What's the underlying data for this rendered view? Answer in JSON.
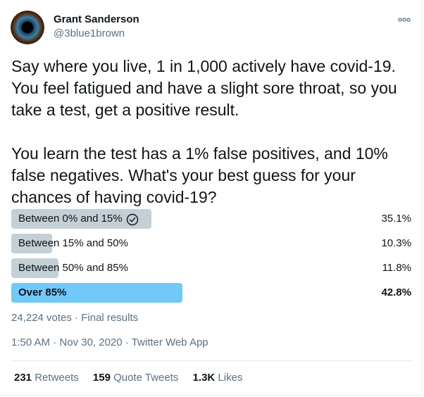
{
  "author": {
    "name": "Grant Sanderson",
    "handle": "@3blue1brown",
    "avatar_icon": "eye-iris-avatar"
  },
  "more_icon": "more-options-icon",
  "tweet": {
    "paragraph_1": "Say where you live, 1 in 1,000 actively have covid-19. You feel fatigued and have a slight sore throat, so you take a test, get a positive result.",
    "paragraph_2": "You learn the test has a 1% false positives, and 10% false negatives.  What's your best guess for your chances of having covid-19?"
  },
  "poll": {
    "options": [
      {
        "label": "Between 0% and 15%",
        "percent": "35.1%",
        "fraction": 0.351,
        "voted": true
      },
      {
        "label": "Between 15% and 50%",
        "percent": "10.3%",
        "fraction": 0.103,
        "voted": false
      },
      {
        "label": "Between 50% and 85%",
        "percent": "11.8%",
        "fraction": 0.118,
        "voted": false
      },
      {
        "label": "Over 85%",
        "percent": "42.8%",
        "fraction": 0.428,
        "voted": false,
        "winner": true
      }
    ],
    "votes": "24,224 votes",
    "separator": " · ",
    "status": "Final results"
  },
  "meta": {
    "time": "1:50 AM",
    "date": "Nov 30, 2020",
    "source": "Twitter Web App",
    "separator": " · "
  },
  "stats": {
    "retweets_count": "231",
    "retweets_label": "Retweets",
    "quotes_count": "159",
    "quotes_label": "Quote Tweets",
    "likes_count": "1.3K",
    "likes_label": "Likes"
  },
  "colors": {
    "bar": "#c4cfd6",
    "winner_bar": "#71c9f8",
    "secondary_text": "#5b7083"
  }
}
